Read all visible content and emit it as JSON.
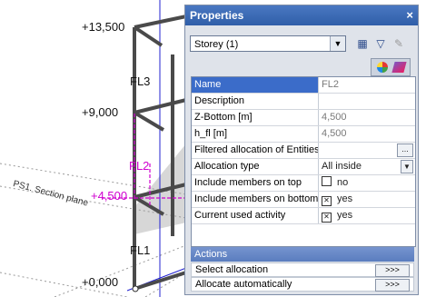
{
  "viewport": {
    "levels": [
      "+13,500",
      "+9,000",
      "+4,500",
      "+0,000"
    ],
    "storey_labels": [
      "FL3",
      "FL2",
      "FL1"
    ],
    "section_label": "PS1. Section plane"
  },
  "panel": {
    "title": "Properties",
    "close": "×",
    "storey_selected": "Storey (1)",
    "rows": [
      {
        "key": "Name",
        "value": "FL2"
      },
      {
        "key": "Description",
        "value": ""
      },
      {
        "key": "Z-Bottom [m]",
        "value": "4,500"
      },
      {
        "key": "h_fl [m]",
        "value": "4,500"
      },
      {
        "key": "Filtered allocation of Entities",
        "value": ""
      },
      {
        "key": "Allocation type",
        "value": "All inside"
      },
      {
        "key": "Include members on top",
        "value": "no"
      },
      {
        "key": "Include members on bottom",
        "value": "yes"
      },
      {
        "key": "Current used activity",
        "value": "yes"
      }
    ],
    "actions_title": "Actions",
    "actions": [
      {
        "label": "Select allocation",
        "button": ">>>"
      },
      {
        "label": "Allocate automatically",
        "button": ">>>"
      }
    ]
  },
  "colors": {
    "title_bar": "#2f5ea8",
    "selection": "#3b6cc9",
    "section_magenta": "#d000d0",
    "axis_blue": "#2020d0"
  }
}
